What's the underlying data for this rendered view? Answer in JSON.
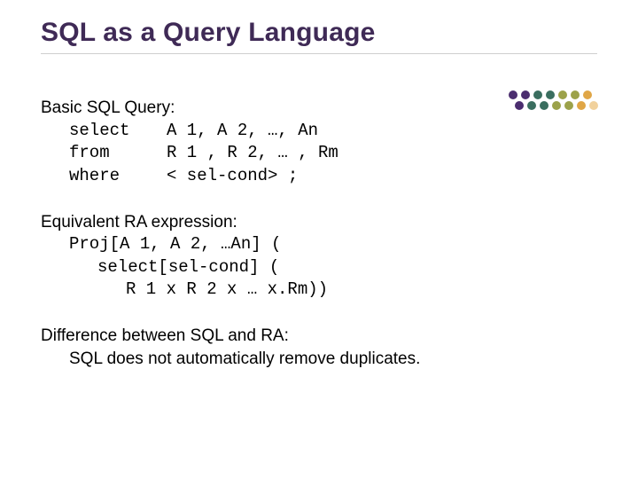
{
  "title": "SQL as a Query Language",
  "sql": {
    "lead": "Basic SQL Query:",
    "select_kw": "select",
    "select_args": "A 1, A 2, …, An",
    "from_kw": "from",
    "from_args": "R 1 , R 2, … , Rm",
    "where_kw": "where",
    "where_args": "< sel-cond> ;"
  },
  "ra": {
    "lead": "Equivalent RA expression:",
    "line1": "Proj[A 1, A 2, …An] (",
    "line2": "select[sel-cond] (",
    "line3": "R 1 x R 2 x … x.Rm))"
  },
  "diff": {
    "lead": "Difference between SQL and RA:",
    "line1": "SQL does not automatically remove duplicates."
  }
}
